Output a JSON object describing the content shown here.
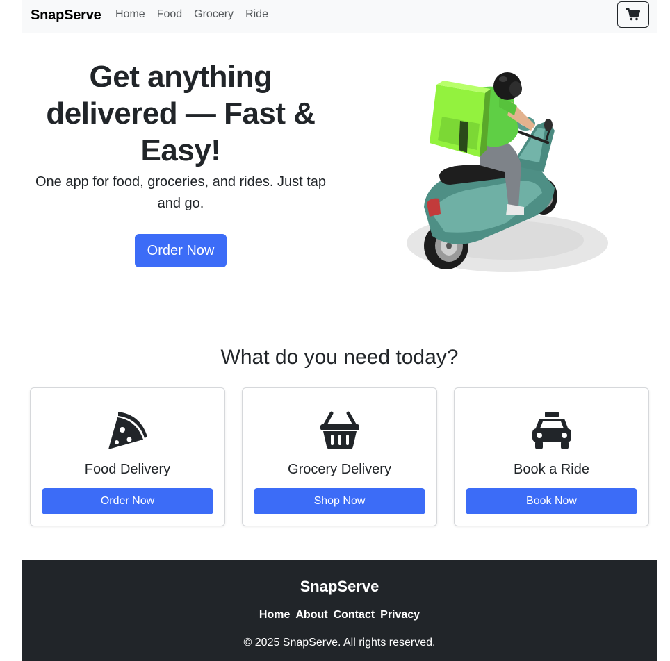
{
  "navbar": {
    "brand": "SnapServe",
    "links": [
      "Home",
      "Food",
      "Grocery",
      "Ride"
    ],
    "cart_icon": "cart-icon"
  },
  "hero": {
    "title": "Get anything delivered — Fast & Easy!",
    "subtitle": "One app for food, groceries, and rides. Just tap and go.",
    "button": "Order Now",
    "image": "scooter-rider-illustration"
  },
  "services": {
    "title": "What do you need today?",
    "cards": [
      {
        "icon": "pizza-slice-icon",
        "title": "Food Delivery",
        "button": "Order Now"
      },
      {
        "icon": "basket-icon",
        "title": "Grocery Delivery",
        "button": "Shop Now"
      },
      {
        "icon": "taxi-icon",
        "title": "Book a Ride",
        "button": "Book Now"
      }
    ]
  },
  "footer": {
    "brand": "SnapServe",
    "links": [
      "Home",
      "About",
      "Contact",
      "Privacy"
    ],
    "copyright": "© 2025 SnapServe. All rights reserved."
  },
  "colors": {
    "primary": "#3c6cf7",
    "navbar_bg": "#f8f9fa",
    "footer_bg": "#212529",
    "text": "#212529"
  }
}
